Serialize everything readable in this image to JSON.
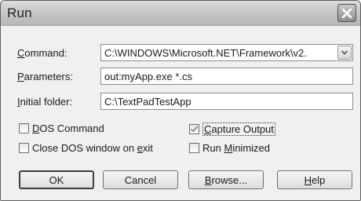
{
  "window": {
    "title": "Run"
  },
  "fields": {
    "command": {
      "label_prefix": "",
      "label_accel": "C",
      "label_rest": "ommand:",
      "value": "C:\\WINDOWS\\Microsoft.NET\\Framework\\v2."
    },
    "parameters": {
      "label_prefix": "",
      "label_accel": "P",
      "label_rest": "arameters:",
      "value": "out:myApp.exe *.cs"
    },
    "initial_folder": {
      "label_prefix": "",
      "label_accel": "I",
      "label_rest": "nitial folder:",
      "value": "C:\\TextPadTestApp"
    }
  },
  "options": {
    "dos_command": {
      "accel": "D",
      "rest": "OS Command",
      "checked": false
    },
    "capture_output": {
      "accel": "C",
      "rest": "apture Output",
      "checked": true
    },
    "close_dos_window": {
      "prefix": "Close DOS window on ",
      "accel": "e",
      "rest": "xit",
      "checked": false
    },
    "run_minimized": {
      "prefix": "Run ",
      "accel": "M",
      "rest": "inimized",
      "checked": false
    }
  },
  "buttons": {
    "ok": "OK",
    "cancel": "Cancel",
    "browse_accel": "B",
    "browse_rest": "rowse...",
    "help_accel": "H",
    "help_rest": "elp"
  },
  "icons": {
    "close": "close-icon",
    "dropdown": "chevron-down-icon",
    "check": "checkmark-icon"
  }
}
